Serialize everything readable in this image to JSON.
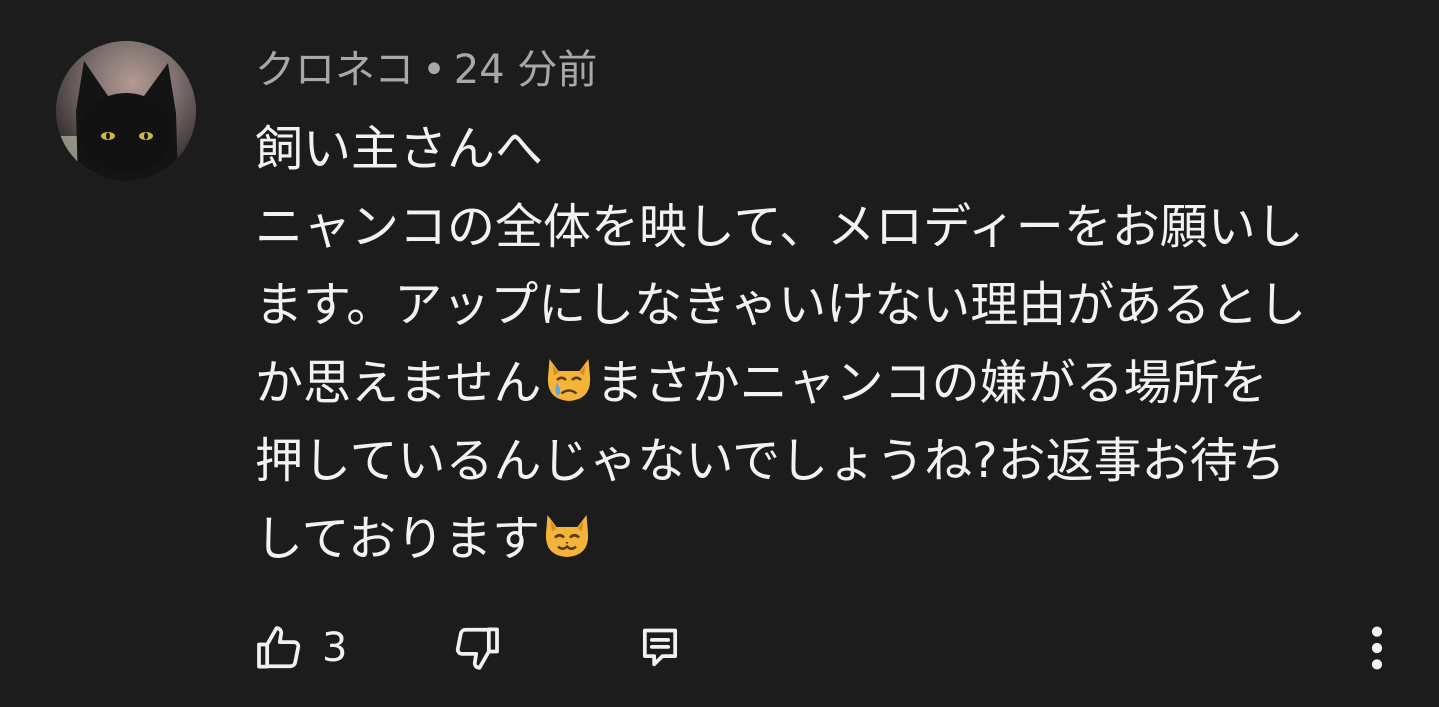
{
  "comment": {
    "author": "クロネコ",
    "separator": "•",
    "time": "24 分前",
    "lines": [
      {
        "segments": [
          {
            "text": "飼い主さんへ"
          }
        ]
      },
      {
        "segments": [
          {
            "text": "ニャンコの全体を映して、メロディーをお願いし"
          }
        ]
      },
      {
        "segments": [
          {
            "text": "ます。アップにしなきゃいけない理由があるとし"
          }
        ]
      },
      {
        "segments": [
          {
            "text": "か思えません"
          },
          {
            "emoji": "crying-cat-emoji"
          },
          {
            "text": "まさかニャンコの嫌がる場所を"
          }
        ]
      },
      {
        "segments": [
          {
            "text": "押しているんじゃないでしょうね?お返事お待ち"
          }
        ]
      },
      {
        "segments": [
          {
            "text": "しております"
          },
          {
            "emoji": "smiling-cat-emoji"
          }
        ]
      }
    ],
    "like_count": "3"
  },
  "icons": {
    "like": "thumbs-up-icon",
    "dislike": "thumbs-down-icon",
    "reply": "reply-comment-icon",
    "more": "more-vertical-icon"
  },
  "colors": {
    "background": "#1c1c1c",
    "text": "#f1f1f1",
    "meta": "#a8a8a8"
  }
}
